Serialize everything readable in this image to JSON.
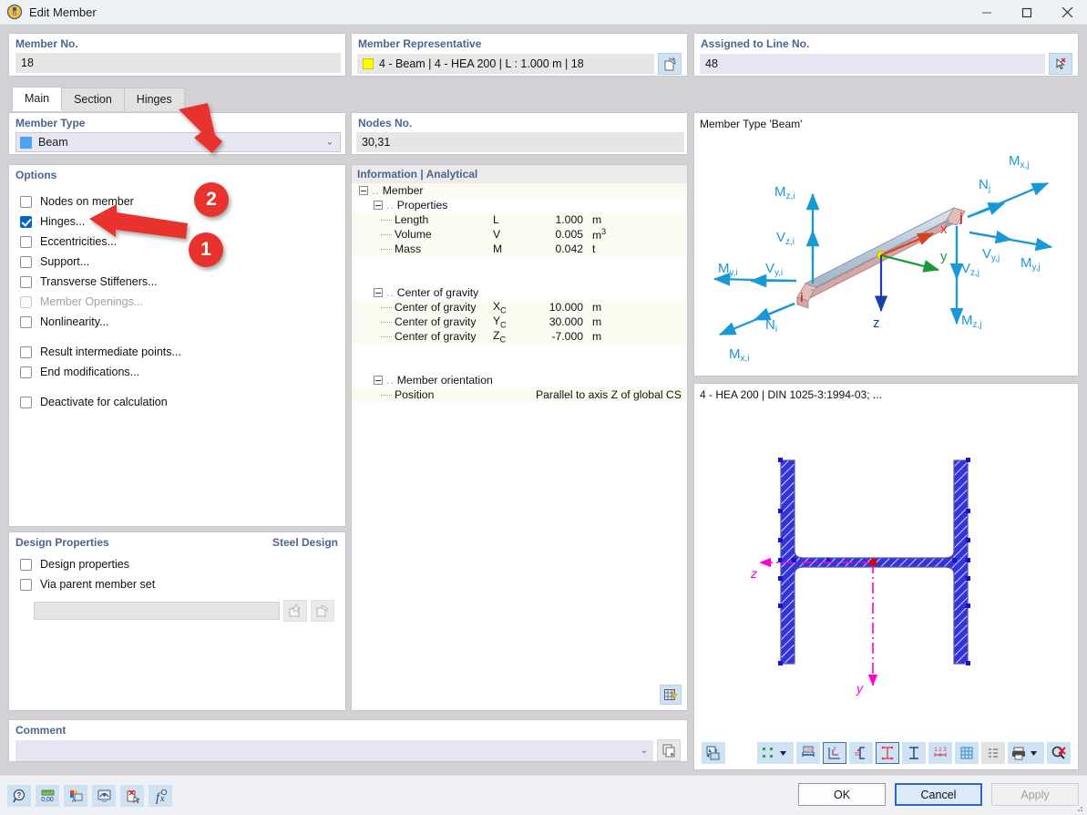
{
  "window": {
    "title": "Edit Member",
    "icon": "member-icon",
    "minimize": "—",
    "maximize": "□",
    "close": "✕"
  },
  "member_no": {
    "label": "Member No.",
    "value": "18"
  },
  "member_representative": {
    "label": "Member Representative",
    "value": "4 - Beam | 4 - HEA 200 | L : 1.000 m | 18",
    "swatch_color": "#ffff00",
    "button_icon": "edit-properties-icon"
  },
  "assigned_to_line": {
    "label": "Assigned to Line No.",
    "value": "48",
    "button_icon": "pick-line-icon"
  },
  "tabs": [
    {
      "label": "Main",
      "active": true
    },
    {
      "label": "Section",
      "active": false
    },
    {
      "label": "Hinges",
      "active": false
    }
  ],
  "member_type": {
    "label": "Member Type",
    "value": "Beam",
    "swatch_color": "#4da3f0",
    "chevron": "⌄"
  },
  "options": {
    "label": "Options",
    "items": [
      {
        "label": "Nodes on member",
        "checked": false,
        "disabled": false,
        "gap_after": false
      },
      {
        "label": "Hinges...",
        "checked": true,
        "disabled": false,
        "gap_after": false
      },
      {
        "label": "Eccentricities...",
        "checked": false,
        "disabled": false,
        "gap_after": false
      },
      {
        "label": "Support...",
        "checked": false,
        "disabled": false,
        "gap_after": false
      },
      {
        "label": "Transverse Stiffeners...",
        "checked": false,
        "disabled": false,
        "gap_after": false
      },
      {
        "label": "Member Openings...",
        "checked": false,
        "disabled": true,
        "gap_after": false
      },
      {
        "label": "Nonlinearity...",
        "checked": false,
        "disabled": false,
        "gap_after": true
      },
      {
        "label": "Result intermediate points...",
        "checked": false,
        "disabled": false,
        "gap_after": false
      },
      {
        "label": "End modifications...",
        "checked": false,
        "disabled": false,
        "gap_after": true
      },
      {
        "label": "Deactivate for calculation",
        "checked": false,
        "disabled": false,
        "gap_after": false
      }
    ]
  },
  "design_properties": {
    "label": "Design Properties",
    "right_label": "Steel Design",
    "items": [
      {
        "label": "Design properties",
        "checked": false
      },
      {
        "label": "Via parent member set",
        "checked": false
      }
    ],
    "input_value": "",
    "new_button_icon": "new-item-icon",
    "edit_button_icon": "edit-item-icon"
  },
  "comment": {
    "label": "Comment",
    "value": "",
    "chevron": "⌄",
    "button_icon": "copy-icon"
  },
  "nodes_no": {
    "label": "Nodes No.",
    "value": "30,31"
  },
  "information": {
    "label": "Information | Analytical",
    "root": "Member",
    "groups": [
      {
        "name": "Properties",
        "rows": [
          {
            "name": "Length",
            "symbol": "L",
            "sym_sub": "",
            "value": "1.000",
            "unit": "m",
            "unit_sup": ""
          },
          {
            "name": "Volume",
            "symbol": "V",
            "sym_sub": "",
            "value": "0.005",
            "unit": "m",
            "unit_sup": "3"
          },
          {
            "name": "Mass",
            "symbol": "M",
            "sym_sub": "",
            "value": "0.042",
            "unit": "t",
            "unit_sup": ""
          }
        ]
      },
      {
        "name": "Center of gravity",
        "rows": [
          {
            "name": "Center of gravity",
            "symbol": "X",
            "sym_sub": "C",
            "value": "10.000",
            "unit": "m",
            "unit_sup": ""
          },
          {
            "name": "Center of gravity",
            "symbol": "Y",
            "sym_sub": "C",
            "value": "30.000",
            "unit": "m",
            "unit_sup": ""
          },
          {
            "name": "Center of gravity",
            "symbol": "Z",
            "sym_sub": "C",
            "value": "-7.000",
            "unit": "m",
            "unit_sup": ""
          }
        ]
      },
      {
        "name": "Member orientation",
        "rows": [
          {
            "name": "Position",
            "symbol": "",
            "sym_sub": "",
            "value": "",
            "unit": "",
            "unit_sup": "",
            "wide_value": "Parallel to axis Z of global CS"
          }
        ]
      }
    ],
    "bottom_button_icon": "table-export-icon"
  },
  "beam_view": {
    "caption": "Member Type 'Beam'",
    "labels": {
      "Mzi": "M",
      "Mzi_sub": "z,i",
      "Vzi": "V",
      "Vzi_sub": "z,i",
      "Myi": "M",
      "Myi_sub": "y,i",
      "Vyi": "V",
      "Vyi_sub": "y,i",
      "Ni": "N",
      "Ni_sub": "i",
      "Mxi": "M",
      "Mxi_sub": "x,i",
      "Nj": "N",
      "Nj_sub": "j",
      "Mxj": "M",
      "Mxj_sub": "x,j",
      "Vyj": "V",
      "Vyj_sub": "y,j",
      "Myj": "M",
      "Myj_sub": "y,j",
      "Vzj": "V",
      "Vzj_sub": "z,j",
      "Mzj": "M",
      "Mzj_sub": "z,j",
      "axis_x": "x",
      "axis_y": "y",
      "axis_z": "z",
      "node_i": "i",
      "node_j": "j"
    }
  },
  "section_view": {
    "caption": "4 - HEA 200 | DIN 1025-3:1994-03; ...",
    "axis_y": "y",
    "axis_z": "z",
    "hatch_color": "#3333cc",
    "axis_color": "#ff00cc"
  },
  "right_toolbar": [
    {
      "icon": "render-mode-icon",
      "name": "render-mode-button",
      "framed": false,
      "gray": false,
      "wide": false
    },
    {
      "icon": "node-display-icon",
      "name": "node-display-button",
      "framed": false,
      "gray": false,
      "wide": true,
      "dropdown": true
    },
    {
      "icon": "dimension-icon",
      "name": "dimensions-button",
      "framed": false,
      "gray": false,
      "wide": false
    },
    {
      "icon": "axis-system-icon",
      "name": "local-axes-button",
      "framed": true,
      "gray": false,
      "wide": false
    },
    {
      "icon": "shear-center-icon",
      "name": "shear-center-button",
      "framed": false,
      "gray": false,
      "wide": false
    },
    {
      "icon": "section-dims-icon",
      "name": "section-dimensions-button",
      "framed": true,
      "gray": false,
      "wide": false
    },
    {
      "icon": "section-outline-icon",
      "name": "section-outline-button",
      "framed": false,
      "gray": false,
      "wide": false
    },
    {
      "icon": "numbering-icon",
      "name": "numbering-button",
      "framed": false,
      "gray": false,
      "wide": false
    },
    {
      "icon": "grid-icon",
      "name": "grid-button",
      "framed": false,
      "gray": false,
      "wide": false
    },
    {
      "icon": "list-icon",
      "name": "list-button",
      "framed": false,
      "gray": true,
      "wide": false
    },
    {
      "icon": "print-icon",
      "name": "print-button",
      "framed": false,
      "gray": false,
      "wide": true,
      "dropdown": true
    },
    {
      "icon": "zoom-reset-icon",
      "name": "zoom-reset-button",
      "framed": false,
      "gray": false,
      "wide": false
    }
  ],
  "right_toolbar_left_button": {
    "icon": "view-export-icon",
    "name": "view-export-button"
  },
  "bottom_toolbar": [
    {
      "icon": "help-icon",
      "name": "help-button"
    },
    {
      "icon": "units-icon",
      "name": "units-button"
    },
    {
      "icon": "display-properties-icon",
      "name": "display-properties-button"
    },
    {
      "icon": "visibility-icon",
      "name": "visibility-button"
    },
    {
      "icon": "delete-icon",
      "name": "delete-button"
    },
    {
      "icon": "formula-icon",
      "name": "formula-button"
    }
  ],
  "dialog_buttons": [
    {
      "label": "OK",
      "name": "ok-button",
      "state": "normal"
    },
    {
      "label": "Cancel",
      "name": "cancel-button",
      "state": "focus"
    },
    {
      "label": "Apply",
      "name": "apply-button",
      "state": "disabled"
    }
  ],
  "annotations": [
    {
      "number": "1",
      "color": "#e8322d"
    },
    {
      "number": "2",
      "color": "#e8322d"
    }
  ]
}
